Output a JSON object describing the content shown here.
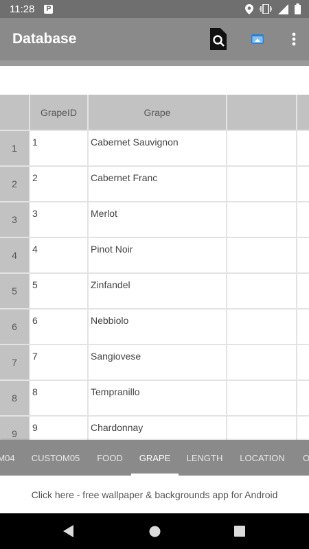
{
  "status_bar": {
    "time": "11:28",
    "notification_icon": "parking-p-icon",
    "right_icons": [
      "location-icon",
      "vibrate-icon",
      "signal-icon",
      "battery-icon"
    ]
  },
  "app_bar": {
    "title": "Database",
    "actions": [
      "search-icon",
      "window-icon",
      "more-vert-icon"
    ],
    "background": "#8a8a8a"
  },
  "search": {
    "value": ""
  },
  "grid": {
    "columns": [
      "GrapeID",
      "Grape",
      "",
      ""
    ],
    "rows": [
      {
        "num": "1",
        "id": "1",
        "grape": "Cabernet Sauvignon"
      },
      {
        "num": "2",
        "id": "2",
        "grape": "Cabernet Franc"
      },
      {
        "num": "3",
        "id": "3",
        "grape": "Merlot"
      },
      {
        "num": "4",
        "id": "4",
        "grape": "Pinot Noir"
      },
      {
        "num": "5",
        "id": "5",
        "grape": "Zinfandel"
      },
      {
        "num": "6",
        "id": "6",
        "grape": "Nebbiolo"
      },
      {
        "num": "7",
        "id": "7",
        "grape": "Sangiovese"
      },
      {
        "num": "8",
        "id": "8",
        "grape": "Tempranillo"
      },
      {
        "num": "9",
        "id": "9",
        "grape": "Chardonnay"
      }
    ]
  },
  "tabs": {
    "items": [
      "M04",
      "CUSTOM05",
      "FOOD",
      "GRAPE",
      "LENGTH",
      "LOCATION",
      "O"
    ],
    "active": "GRAPE"
  },
  "ad_banner": {
    "text": "Click here - free wallpaper & backgrounds app for Android"
  },
  "nav_bar": {
    "buttons": [
      "back-icon",
      "home-icon",
      "recents-icon"
    ]
  }
}
